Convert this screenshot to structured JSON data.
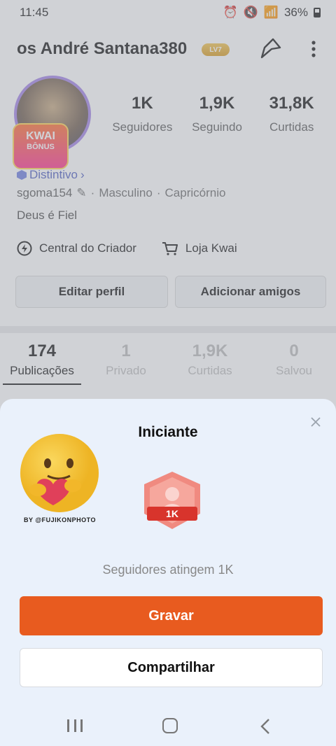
{
  "status_bar": {
    "time": "11:45",
    "battery": "36%"
  },
  "header": {
    "name": "os André Santana380",
    "level": "LV7"
  },
  "profile": {
    "stats": [
      {
        "value": "1K",
        "label": "Seguidores"
      },
      {
        "value": "1,9K",
        "label": "Seguindo"
      },
      {
        "value": "31,8K",
        "label": "Curtidas"
      }
    ],
    "bonus_line1": "KWAI",
    "bonus_line2": "BÔNUS",
    "distintivo": "Distintivo",
    "username": "sgoma154",
    "gender": "Masculino",
    "sign": "Capricórnio",
    "bio": "Deus é Fiel"
  },
  "links": {
    "creator": "Central do Criador",
    "shop": "Loja Kwai"
  },
  "buttons": {
    "edit": "Editar perfil",
    "add_friends": "Adicionar amigos"
  },
  "tabs": [
    {
      "count": "174",
      "label": "Publicações"
    },
    {
      "count": "1",
      "label": "Privado"
    },
    {
      "count": "1,9K",
      "label": "Curtidas"
    },
    {
      "count": "0",
      "label": "Salvou"
    }
  ],
  "sheet": {
    "title": "Iniciante",
    "emoji_credit": "BY @FUJIKONPHOTO",
    "badge_text": "1K",
    "description": "Seguidores atingem 1K",
    "record_label": "Gravar",
    "share_label": "Compartilhar"
  },
  "colors": {
    "accent": "#e85b1f",
    "sheet_bg": "#eaf1fb"
  }
}
